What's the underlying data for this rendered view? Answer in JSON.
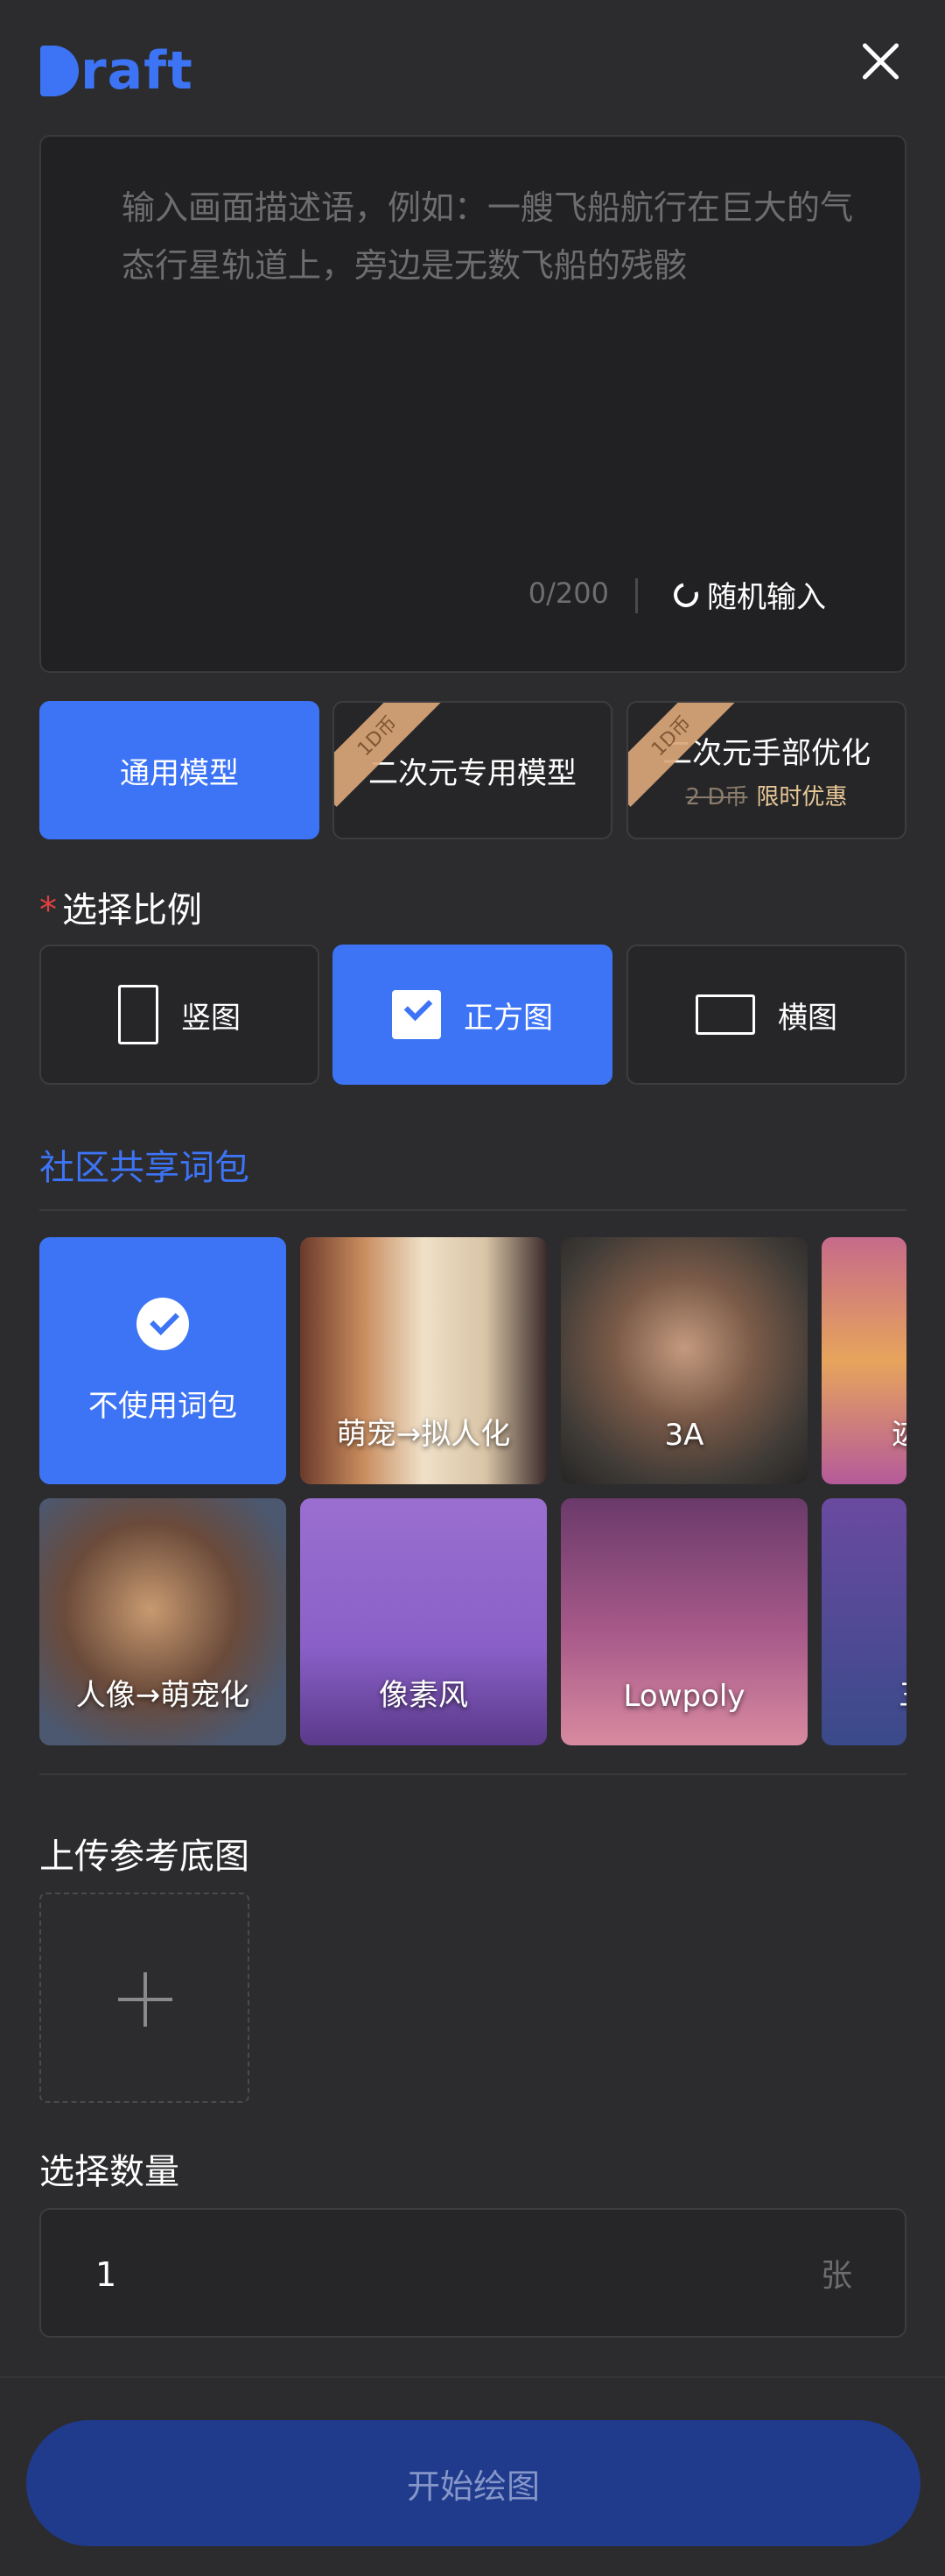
{
  "header": {
    "logo_letter": "D",
    "logo_text": "raft"
  },
  "prompt": {
    "placeholder": "输入画面描述语，例如：一艘飞船航行在巨大的气态行星轨道上，旁边是无数飞船的残骸",
    "value": "",
    "counter": "0/200",
    "random_label": "随机输入"
  },
  "models": [
    {
      "label": "通用模型",
      "active": true
    },
    {
      "label": "二次元专用模型",
      "badge": "1D币"
    },
    {
      "label": "二次元手部优化",
      "badge": "1D币",
      "old_price": "2 D币",
      "promo": "限时优惠"
    }
  ],
  "ratio": {
    "title": "选择比例",
    "required_mark": "*",
    "options": [
      {
        "label": "竖图",
        "icon": "portrait-frame-icon"
      },
      {
        "label": "正方图",
        "icon": "checkbox-icon",
        "active": true
      },
      {
        "label": "横图",
        "icon": "landscape-frame-icon"
      }
    ]
  },
  "community": {
    "title": "社区共享词包",
    "tiles_row1": [
      {
        "label": "不使用词包",
        "selected": true
      },
      {
        "label": "萌宠→拟人化"
      },
      {
        "label": "3A"
      },
      {
        "label": "迹"
      }
    ],
    "tiles_row2": [
      {
        "label": "人像→萌宠化"
      },
      {
        "label": "像素风"
      },
      {
        "label": "Lowpoly"
      },
      {
        "label": "三"
      }
    ]
  },
  "upload": {
    "title": "上传参考底图"
  },
  "quantity": {
    "title": "选择数量",
    "value": "1",
    "unit": "张"
  },
  "start_button": "开始绘图",
  "colors": {
    "accent": "#3d74f5",
    "background": "#2c2c2e",
    "promo": "#e8c896",
    "required": "#e04040"
  }
}
